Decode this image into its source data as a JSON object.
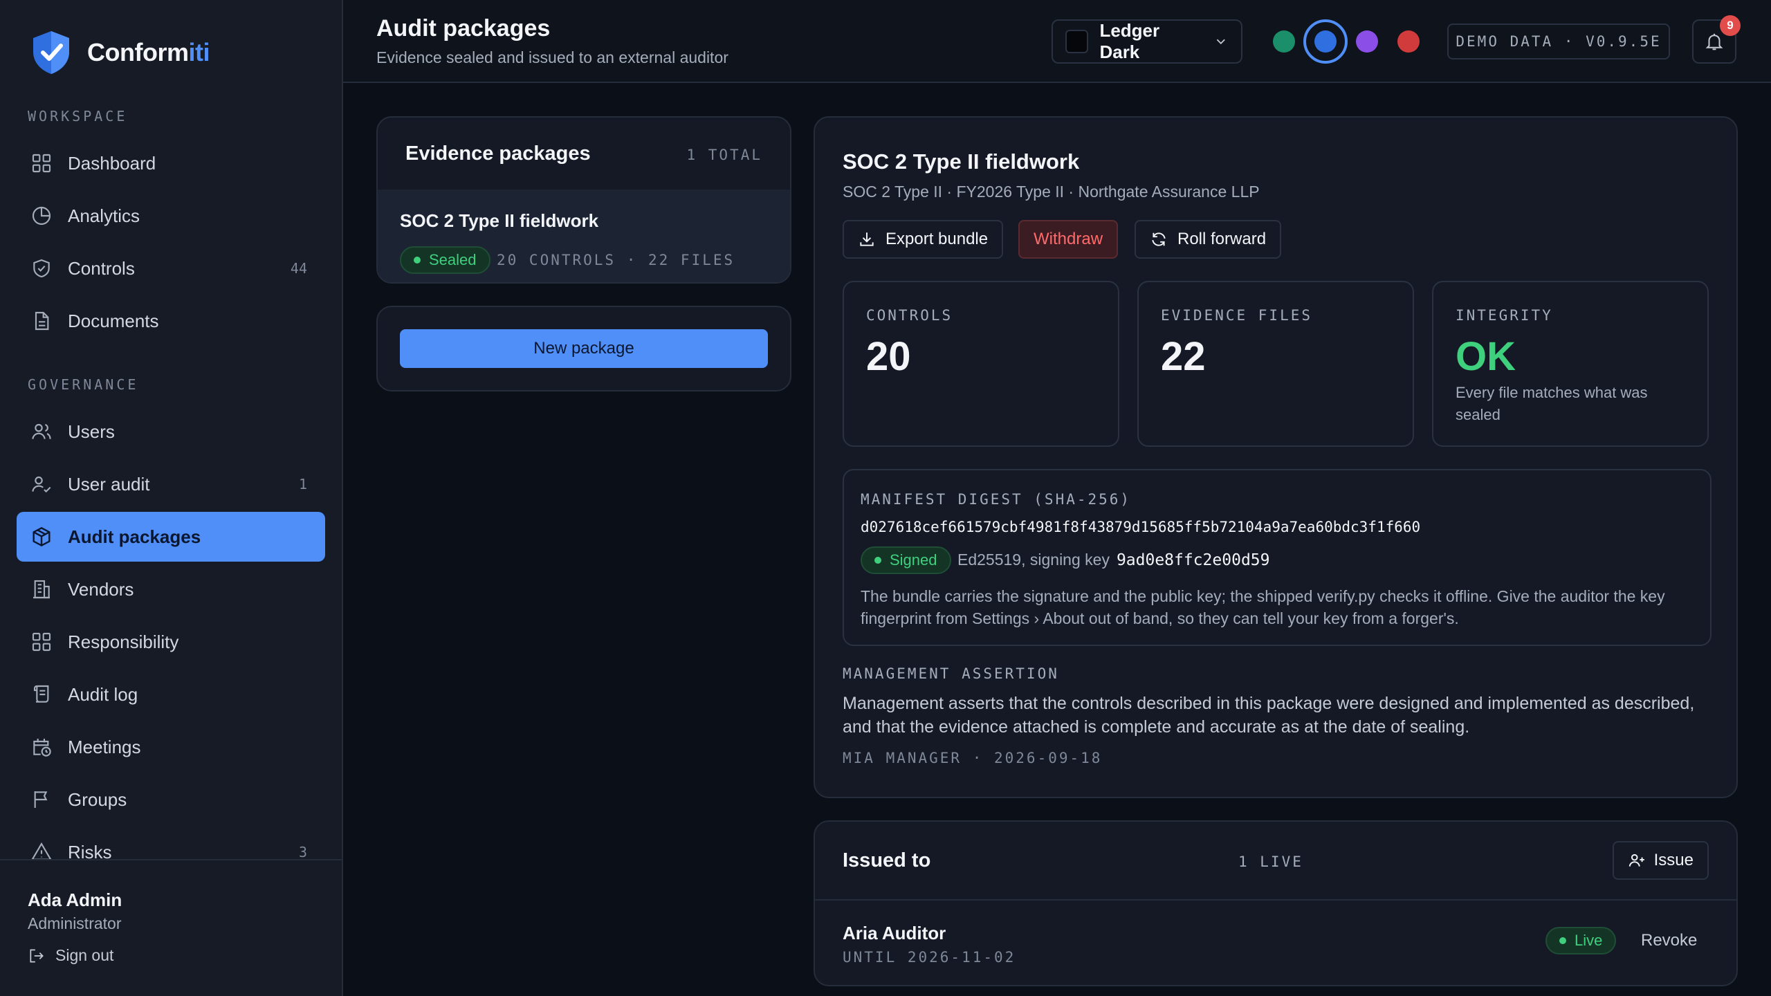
{
  "brand": {
    "name_prefix": "Conform",
    "name_suffix": "iti",
    "accent": "#4f8ff7"
  },
  "sidebar": {
    "workspace_label": "WORKSPACE",
    "governance_label": "GOVERNANCE",
    "workspace_items": [
      {
        "label": "Dashboard",
        "icon": "grid-icon"
      },
      {
        "label": "Analytics",
        "icon": "pie-chart-icon"
      },
      {
        "label": "Controls",
        "icon": "shield-check-icon",
        "count": "44"
      },
      {
        "label": "Documents",
        "icon": "document-icon"
      }
    ],
    "governance_items": [
      {
        "label": "Users",
        "icon": "users-icon"
      },
      {
        "label": "User audit",
        "icon": "user-check-icon",
        "count": "1"
      },
      {
        "label": "Audit packages",
        "icon": "package-icon",
        "active": true
      },
      {
        "label": "Vendors",
        "icon": "building-icon"
      },
      {
        "label": "Responsibility",
        "icon": "grid-icon"
      },
      {
        "label": "Audit log",
        "icon": "scroll-icon"
      },
      {
        "label": "Meetings",
        "icon": "calendar-clock-icon"
      },
      {
        "label": "Groups",
        "icon": "flag-icon"
      },
      {
        "label": "Risks",
        "icon": "warning-icon",
        "count": "3"
      }
    ],
    "user": {
      "name": "Ada Admin",
      "role": "Administrator",
      "signout": "Sign out"
    }
  },
  "header": {
    "title": "Audit packages",
    "subtitle": "Evidence sealed and issued to an external auditor",
    "theme": "Ledger Dark",
    "accents": [
      "#1a8f6a",
      "#2f6fe0",
      "#8b4fe8",
      "#d23b3b"
    ],
    "demo_badge": "DEMO DATA · V0.9.5E",
    "notifications": "9"
  },
  "packages": {
    "title": "Evidence packages",
    "total": "1 TOTAL",
    "items": [
      {
        "name": "SOC 2 Type II fieldwork",
        "status": "Sealed",
        "meta": "20 CONTROLS · 22 FILES"
      }
    ],
    "new_button": "New package"
  },
  "detail": {
    "title": "SOC 2 Type II fieldwork",
    "subtitle": "SOC 2 Type II · FY2026 Type II · Northgate Assurance LLP",
    "actions": {
      "export": "Export bundle",
      "withdraw": "Withdraw",
      "roll": "Roll forward"
    },
    "stats": {
      "controls_label": "CONTROLS",
      "controls_value": "20",
      "files_label": "EVIDENCE FILES",
      "files_value": "22",
      "integrity_label": "INTEGRITY",
      "integrity_value": "OK",
      "integrity_note": "Every file matches what was sealed"
    },
    "digest": {
      "label": "MANIFEST DIGEST (SHA-256)",
      "hash": "d027618cef661579cbf4981f8f43879d15685ff5b72104a9a7ea60bdc3f1f660",
      "status": "Signed",
      "key_text": "Ed25519, signing key",
      "key": "9ad0e8ffc2e00d59",
      "note": "The bundle carries the signature and the public key; the shipped verify.py checks it offline. Give the auditor the key fingerprint from Settings › About out of band, so they can tell your key from a forger's."
    },
    "assertion": {
      "label": "MANAGEMENT ASSERTION",
      "text": "Management asserts that the controls described in this package were designed and implemented as described, and that the evidence attached is complete and accurate as at the date of sealing.",
      "by": "MIA MANAGER · 2026-09-18"
    }
  },
  "issued": {
    "title": "Issued to",
    "live": "1 LIVE",
    "issue_button": "Issue",
    "auditors": [
      {
        "name": "Aria Auditor",
        "until": "UNTIL 2026-11-02",
        "status": "Live",
        "action": "Revoke"
      }
    ]
  }
}
